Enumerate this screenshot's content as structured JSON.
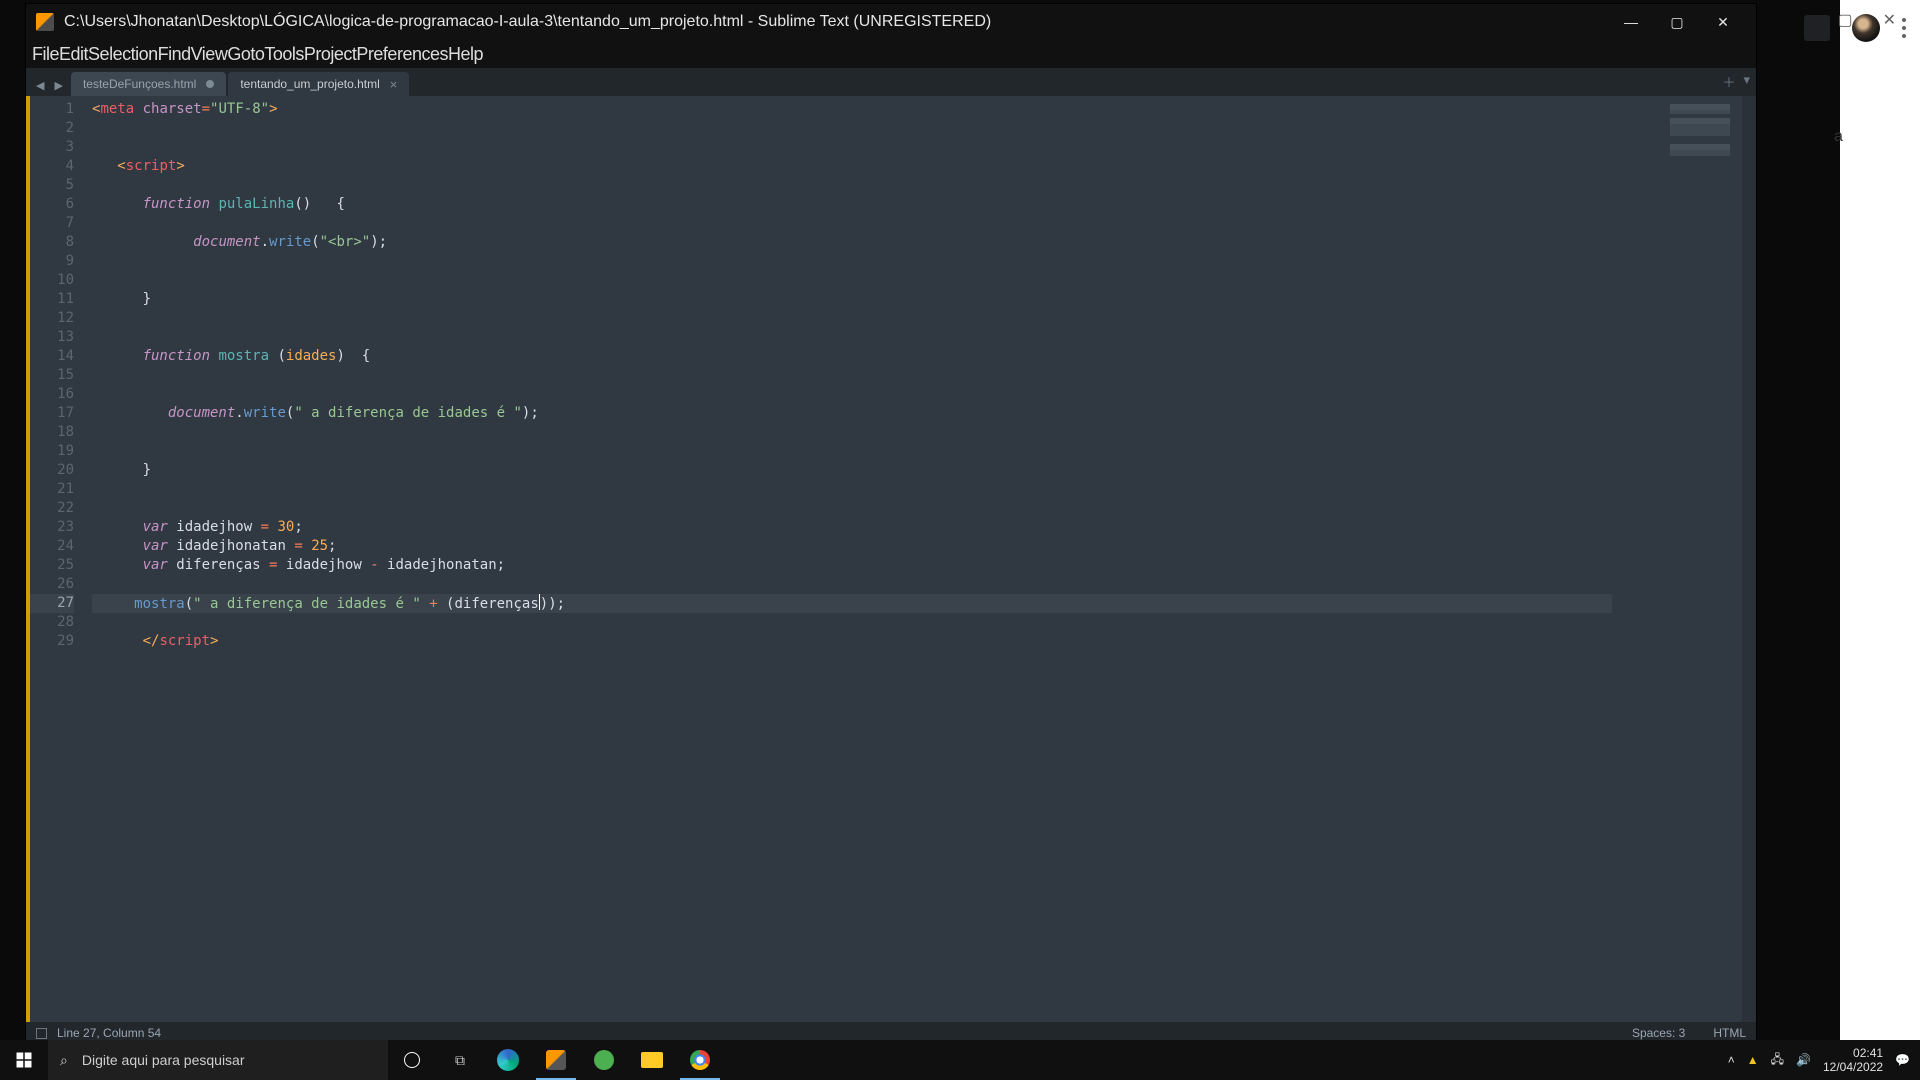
{
  "window": {
    "title": "C:\\Users\\Jhonatan\\Desktop\\LÓGICA\\logica-de-programacao-I-aula-3\\tentando_um_projeto.html - Sublime Text (UNREGISTERED)"
  },
  "menu": [
    "File",
    "Edit",
    "Selection",
    "Find",
    "View",
    "Goto",
    "Tools",
    "Project",
    "Preferences",
    "Help"
  ],
  "tabs": [
    {
      "label": "testeDeFunçoes.html",
      "active": false,
      "dirty": true
    },
    {
      "label": "tentando_um_projeto.html",
      "active": true,
      "dirty": false
    }
  ],
  "status": {
    "position": "Line 27, Column 54",
    "spaces": "Spaces: 3",
    "syntax": "HTML"
  },
  "cursor_line": 27,
  "code_lines": [
    {
      "n": 1,
      "tokens": [
        [
          "tag",
          "<"
        ],
        [
          "tagkw",
          "meta"
        ],
        [
          "plain",
          " "
        ],
        [
          "attr",
          "charset"
        ],
        [
          "op",
          "="
        ],
        [
          "str",
          "\"UTF-8\""
        ],
        [
          "tag",
          ">"
        ]
      ]
    },
    {
      "n": 2,
      "tokens": []
    },
    {
      "n": 3,
      "tokens": []
    },
    {
      "n": 4,
      "tokens": [
        [
          "plain",
          "   "
        ],
        [
          "tag",
          "<"
        ],
        [
          "tagkw",
          "script"
        ],
        [
          "tag",
          ">"
        ]
      ]
    },
    {
      "n": 5,
      "tokens": []
    },
    {
      "n": 6,
      "tokens": [
        [
          "plain",
          "      "
        ],
        [
          "kw",
          "function"
        ],
        [
          "plain",
          " "
        ],
        [
          "fn",
          "pulaLinha"
        ],
        [
          "plain",
          "()   {"
        ]
      ]
    },
    {
      "n": 7,
      "tokens": []
    },
    {
      "n": 8,
      "tokens": [
        [
          "plain",
          "            "
        ],
        [
          "kw",
          "document"
        ],
        [
          "plain",
          "."
        ],
        [
          "fn2",
          "write"
        ],
        [
          "plain",
          "("
        ],
        [
          "str",
          "\"<br>\""
        ],
        [
          "plain",
          ");"
        ]
      ]
    },
    {
      "n": 9,
      "tokens": []
    },
    {
      "n": 10,
      "tokens": []
    },
    {
      "n": 11,
      "tokens": [
        [
          "plain",
          "      }"
        ]
      ]
    },
    {
      "n": 12,
      "tokens": []
    },
    {
      "n": 13,
      "tokens": []
    },
    {
      "n": 14,
      "tokens": [
        [
          "plain",
          "      "
        ],
        [
          "kw",
          "function"
        ],
        [
          "plain",
          " "
        ],
        [
          "fn",
          "mostra"
        ],
        [
          "plain",
          " ("
        ],
        [
          "param",
          "idades"
        ],
        [
          "plain",
          ")  {"
        ]
      ]
    },
    {
      "n": 15,
      "tokens": []
    },
    {
      "n": 16,
      "tokens": []
    },
    {
      "n": 17,
      "tokens": [
        [
          "plain",
          "         "
        ],
        [
          "kw",
          "document"
        ],
        [
          "plain",
          "."
        ],
        [
          "fn2",
          "write"
        ],
        [
          "plain",
          "("
        ],
        [
          "str",
          "\" a diferença de idades é \""
        ],
        [
          "plain",
          ");"
        ]
      ]
    },
    {
      "n": 18,
      "tokens": []
    },
    {
      "n": 19,
      "tokens": []
    },
    {
      "n": 20,
      "tokens": [
        [
          "plain",
          "      }"
        ]
      ]
    },
    {
      "n": 21,
      "tokens": []
    },
    {
      "n": 22,
      "tokens": []
    },
    {
      "n": 23,
      "tokens": [
        [
          "plain",
          "      "
        ],
        [
          "kw",
          "var"
        ],
        [
          "plain",
          " idadejhow "
        ],
        [
          "op",
          "="
        ],
        [
          "plain",
          " "
        ],
        [
          "num",
          "30"
        ],
        [
          "plain",
          ";"
        ]
      ]
    },
    {
      "n": 24,
      "tokens": [
        [
          "plain",
          "      "
        ],
        [
          "kw",
          "var"
        ],
        [
          "plain",
          " idadejhonatan "
        ],
        [
          "op",
          "="
        ],
        [
          "plain",
          " "
        ],
        [
          "num",
          "25"
        ],
        [
          "plain",
          ";"
        ]
      ]
    },
    {
      "n": 25,
      "tokens": [
        [
          "plain",
          "      "
        ],
        [
          "kw",
          "var"
        ],
        [
          "plain",
          " diferenças "
        ],
        [
          "op",
          "="
        ],
        [
          "plain",
          " idadejhow "
        ],
        [
          "op",
          "-"
        ],
        [
          "plain",
          " idadejhonatan;"
        ]
      ]
    },
    {
      "n": 26,
      "tokens": []
    },
    {
      "n": 27,
      "tokens": [
        [
          "plain",
          "     "
        ],
        [
          "fn2",
          "mostra"
        ],
        [
          "plain",
          "("
        ],
        [
          "str",
          "\" a diferença de idades é \""
        ],
        [
          "plain",
          " "
        ],
        [
          "op",
          "+"
        ],
        [
          "plain",
          " (diferenças"
        ],
        [
          "cursor",
          ""
        ],
        [
          "plain",
          "));"
        ]
      ]
    },
    {
      "n": 28,
      "tokens": []
    },
    {
      "n": 29,
      "tokens": [
        [
          "plain",
          "      "
        ],
        [
          "tag",
          "</"
        ],
        [
          "tagkw",
          "script"
        ],
        [
          "tag",
          ">"
        ]
      ]
    }
  ],
  "taskbar": {
    "search_placeholder": "Digite aqui para pesquisar",
    "time": "02:41",
    "date": "12/04/2022"
  }
}
